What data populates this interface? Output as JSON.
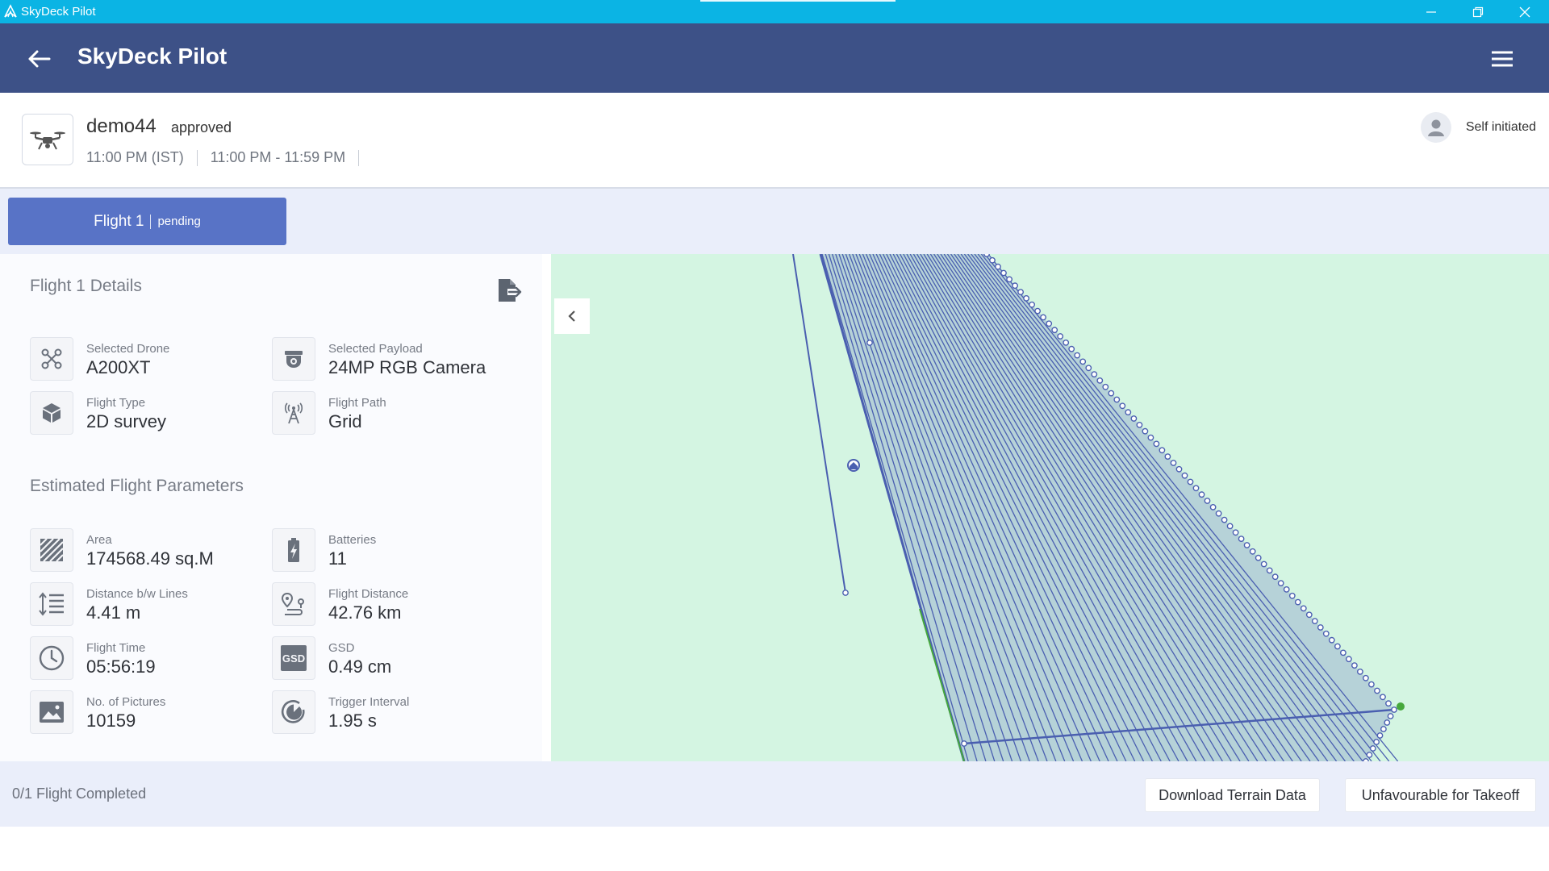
{
  "window": {
    "title": "SkyDeck Pilot"
  },
  "appbar": {
    "title": "SkyDeck Pilot"
  },
  "mission": {
    "name": "demo44",
    "status": "approved",
    "time": "11:00 PM (IST)",
    "window": "11:00 PM - 11:59 PM",
    "initiator": "Self initiated"
  },
  "flight_tab": {
    "label": "Flight 1",
    "status": "pending"
  },
  "details": {
    "title": "Flight 1 Details",
    "drone": {
      "label": "Selected Drone",
      "value": "A200XT"
    },
    "payload": {
      "label": "Selected Payload",
      "value": "24MP RGB Camera"
    },
    "flight_type": {
      "label": "Flight Type",
      "value": "2D survey"
    },
    "flight_path": {
      "label": "Flight Path",
      "value": "Grid"
    }
  },
  "estimates": {
    "title": "Estimated Flight Parameters",
    "area": {
      "label": "Area",
      "value": "174568.49 sq.M"
    },
    "batteries": {
      "label": "Batteries",
      "value": "11"
    },
    "line_distance": {
      "label": "Distance b/w Lines",
      "value": "4.41 m"
    },
    "flight_distance": {
      "label": "Flight Distance",
      "value": "42.76 km"
    },
    "flight_time": {
      "label": "Flight Time",
      "value": "05:56:19"
    },
    "gsd": {
      "label": "GSD",
      "value": "0.49 cm",
      "icon_text": "GSD"
    },
    "pictures": {
      "label": "No. of Pictures",
      "value": "10159"
    },
    "trigger": {
      "label": "Trigger Interval",
      "value": "1.95 s"
    }
  },
  "footer": {
    "progress": "0/1 Flight Completed",
    "download_label": "Download Terrain Data",
    "takeoff_label": "Unfavourable for Takeoff"
  },
  "icons": {
    "app_logo": "skydeck-logo-icon",
    "minimize": "minimize-icon",
    "restore": "restore-icon",
    "close": "close-icon",
    "back": "arrow-left-icon",
    "menu": "hamburger-menu-icon",
    "drone": "drone-icon",
    "user": "user-avatar-icon",
    "export": "export-file-icon",
    "collapse": "chevron-left-icon",
    "home": "home-marker-icon"
  },
  "colors": {
    "titlebar": "#0bb4e4",
    "appbar": "#3d5187",
    "accent": "#5873c6",
    "map_background": "#d4f5e2",
    "flight_path": "#4a5fb0",
    "takeoff_point": "#46a83c"
  }
}
